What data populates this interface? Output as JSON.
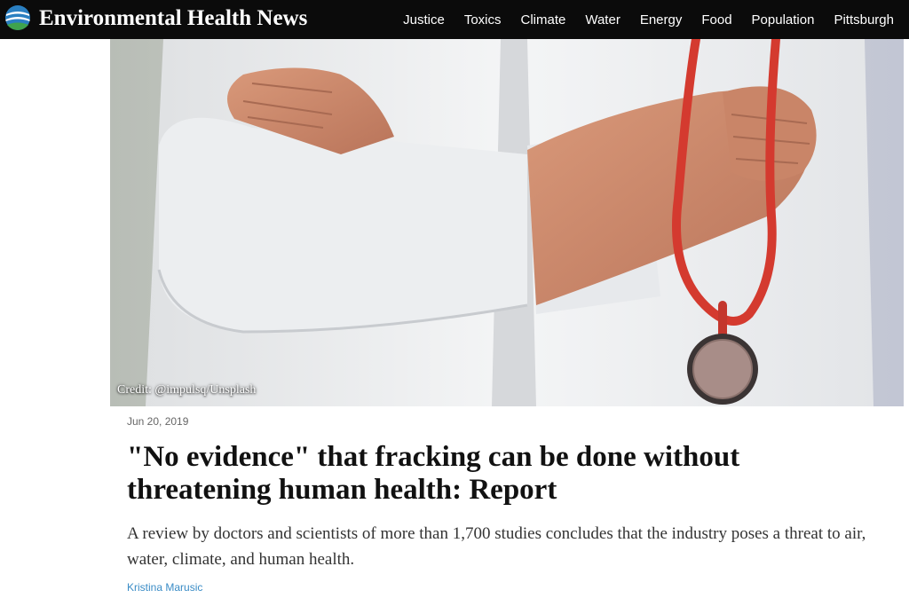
{
  "site": {
    "name": "Environmental Health News",
    "logo_icon": "globe-logo-icon"
  },
  "nav": {
    "items": [
      {
        "label": "Justice"
      },
      {
        "label": "Toxics"
      },
      {
        "label": "Climate"
      },
      {
        "label": "Water"
      },
      {
        "label": "Energy"
      },
      {
        "label": "Food"
      },
      {
        "label": "Population"
      },
      {
        "label": "Pittsburgh"
      }
    ]
  },
  "article": {
    "image_credit": "Credit: @impulsq/Unsplash",
    "date": "Jun 20, 2019",
    "headline": "\"No evidence\" that fracking can be done without threatening human health: Report",
    "summary": "A review by doctors and scientists of more than 1,700 studies concludes that the industry poses a threat to air, water, climate, and human health.",
    "author": "Kristina Marusic"
  },
  "colors": {
    "navbar_bg": "#0b0b0b",
    "author_link": "#3a8cc6",
    "logo_blue": "#2a7fc1",
    "logo_green": "#3fa34d"
  }
}
